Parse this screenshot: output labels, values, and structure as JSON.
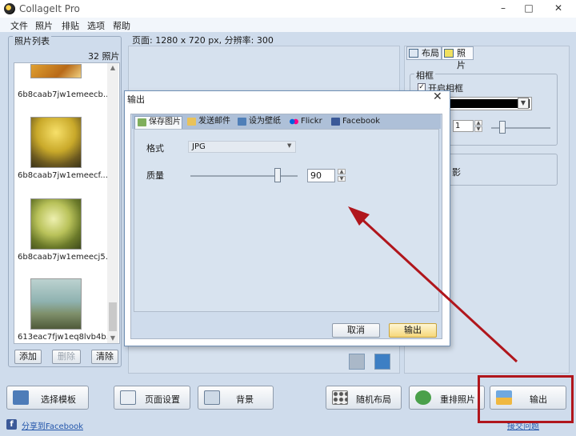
{
  "window": {
    "title": "CollageIt Pro",
    "controls": [
      "–",
      "□",
      "✕"
    ]
  },
  "menu": [
    "文件",
    "照片",
    "排贴",
    "选项",
    "帮助"
  ],
  "photo_list": {
    "title": "照片列表",
    "count": "32 照片",
    "items": [
      {
        "name": "6b8caab7jw1emeecb..."
      },
      {
        "name": "6b8caab7jw1emeecf..."
      },
      {
        "name": "6b8caab7jw1emeecj5..."
      },
      {
        "name": "613eac7fjw1eq8lvb4b..."
      }
    ],
    "buttons": {
      "add": "添加",
      "delete": "删除",
      "clear": "清除"
    }
  },
  "page_info": "页面: 1280 x 720 px, 分辨率: 300",
  "right_panel": {
    "tabs": [
      "布局",
      "照片"
    ],
    "frame_group": "相框",
    "enable_frame": "开启相框",
    "frame_width": "1",
    "shadow_fragment": "影"
  },
  "toolbar": {
    "select_template": "选择模板",
    "page_setup": "页面设置",
    "background": "背景",
    "random_layout": "随机布局",
    "reshuffle_photos": "重排照片",
    "export": "输出"
  },
  "footer": {
    "share_facebook": "分享到Facebook",
    "partial_link": "接交问题"
  },
  "dialog": {
    "title": "输出",
    "tabs": [
      "保存图片",
      "发送邮件",
      "设为壁纸",
      "Flickr",
      "Facebook"
    ],
    "format_label": "格式",
    "format_value": "JPG",
    "quality_label": "质量",
    "quality_value": "90",
    "quality_level": 0.9,
    "cancel": "取消",
    "ok": "输出"
  },
  "colors": {
    "frame_color": "#000000",
    "highlight": "#b0161c",
    "arrow": "#b0161c",
    "facebook": "#3b5998"
  }
}
